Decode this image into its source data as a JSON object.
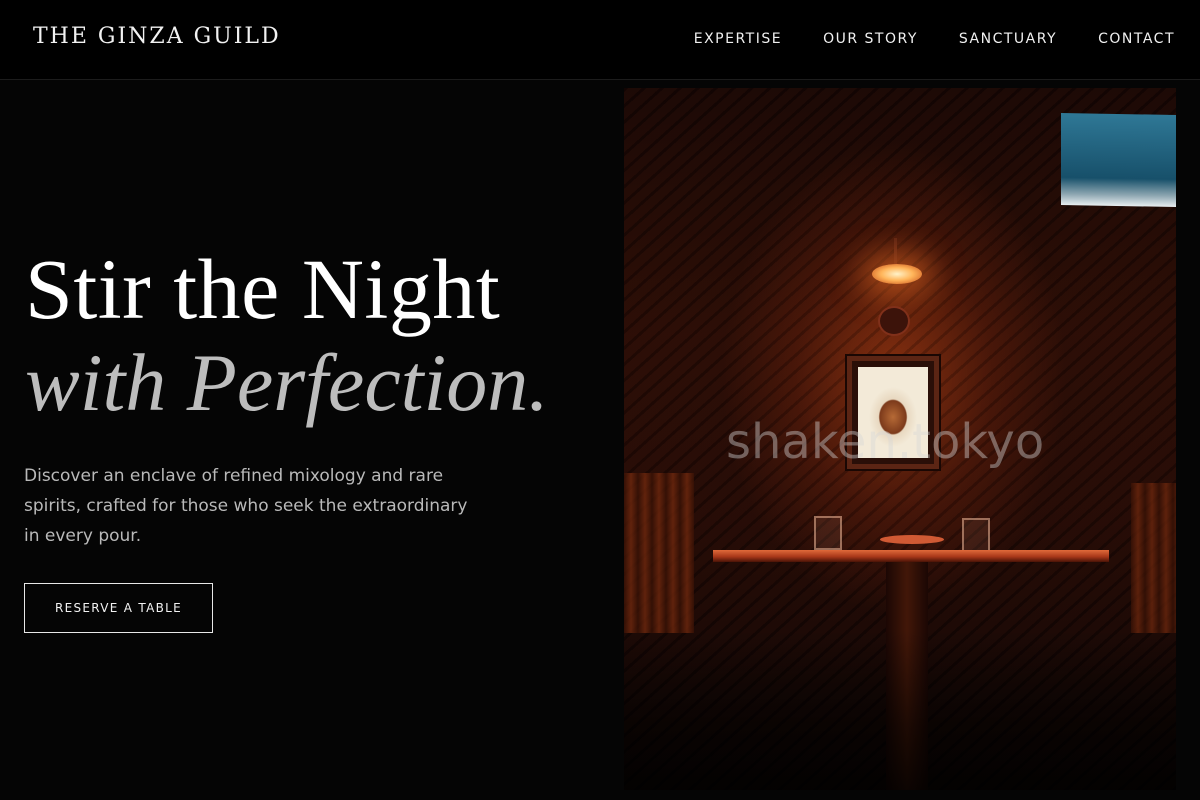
{
  "navbar": {
    "logo": "THE GINZA GUILD",
    "links": [
      "EXPERTISE",
      "OUR STORY",
      "SANCTUARY",
      "CONTACT"
    ]
  },
  "hero": {
    "headline_line1": "Stir the Night",
    "headline_line2": "with Perfection.",
    "intro": "Discover an enclave of refined mixology and rare spirits, crafted for those who seek the extraordinary in every pour.",
    "cta_label": "RESERVE A TABLE",
    "image": {
      "watermark": "shaken.tokyo"
    }
  },
  "colors": {
    "background": "#050505",
    "accent_warm": "#c44512",
    "headline": "#ffffff",
    "headline_italic": "#bdbdbd"
  }
}
